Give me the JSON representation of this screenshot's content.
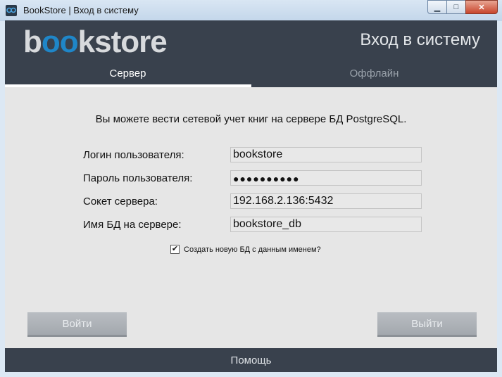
{
  "window": {
    "title": "BookStore | Вход в систему",
    "controls": {
      "minimize": "▁",
      "maximize": "□",
      "close": "✕"
    }
  },
  "header": {
    "logo_prefix": "b",
    "logo_oo": "oo",
    "logo_suffix": "kstore",
    "title": "Вход в систему"
  },
  "tabs": [
    {
      "label": "Сервер",
      "active": true
    },
    {
      "label": "Оффлайн",
      "active": false
    }
  ],
  "info_text": "Вы можете вести сетевой учет книг на сервере БД PostgreSQL.",
  "form": {
    "login_label": "Логин пользователя:",
    "login_value": "bookstore",
    "password_label": "Пароль пользователя:",
    "password_value": "●●●●●●●●●●",
    "socket_label": "Сокет сервера:",
    "socket_value": "192.168.2.136:5432",
    "dbname_label": "Имя БД на сервере:",
    "dbname_value": "bookstore_db",
    "create_db_label": "Создать новую БД с данным именем?",
    "create_db_checked": true
  },
  "buttons": {
    "login": "Войти",
    "exit": "Выйти"
  },
  "footer": {
    "help": "Помощь"
  },
  "colors": {
    "header_bg": "#39414d",
    "accent": "#1f86c8",
    "content_bg": "#e6e6e6",
    "button_bg": "#a9aeb4"
  }
}
